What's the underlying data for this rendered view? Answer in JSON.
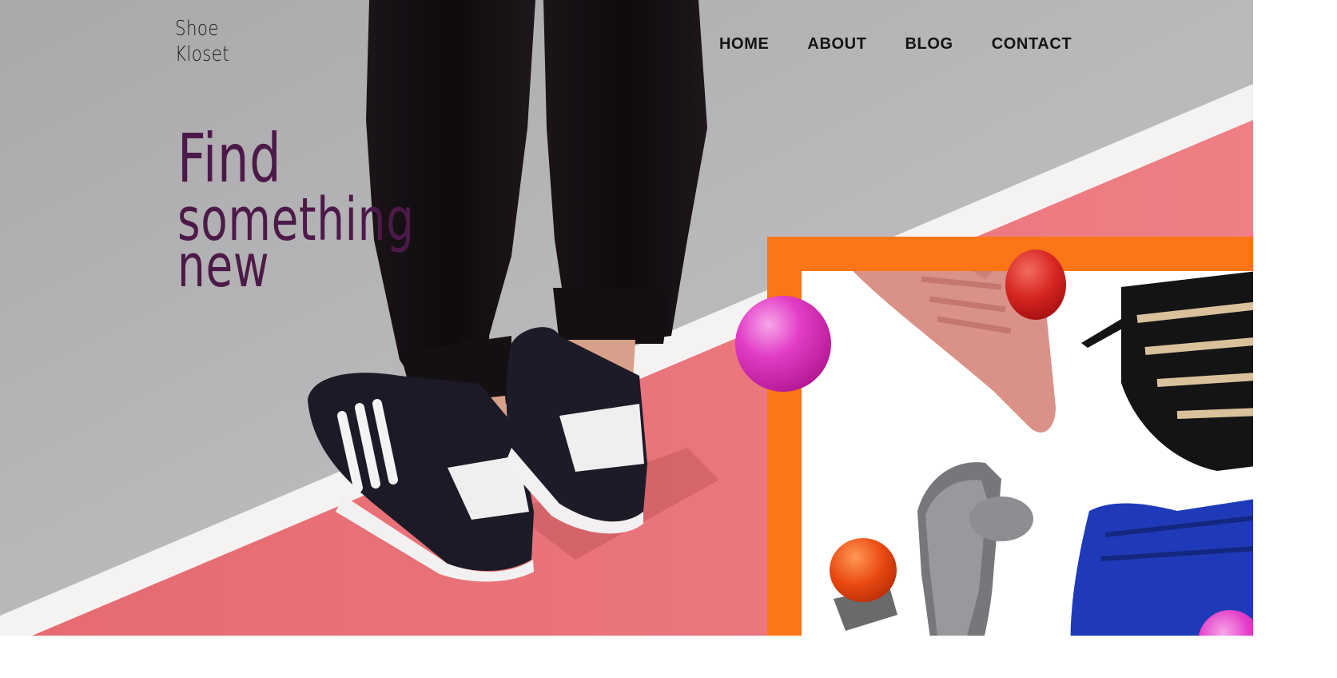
{
  "brand": {
    "line1": "Shoe",
    "line2": "Kloset"
  },
  "nav": {
    "items": [
      {
        "label": "HOME"
      },
      {
        "label": "ABOUT"
      },
      {
        "label": "BLOG"
      },
      {
        "label": "CONTACT"
      }
    ]
  },
  "hero": {
    "headline_line1": "Find",
    "headline_line2": "something",
    "headline_line3": "new"
  },
  "colors": {
    "headline": "#4c1a48",
    "accent_orange": "#fc7517",
    "track_red": "#e5686f",
    "ground_gray": "#b2b1b3"
  }
}
